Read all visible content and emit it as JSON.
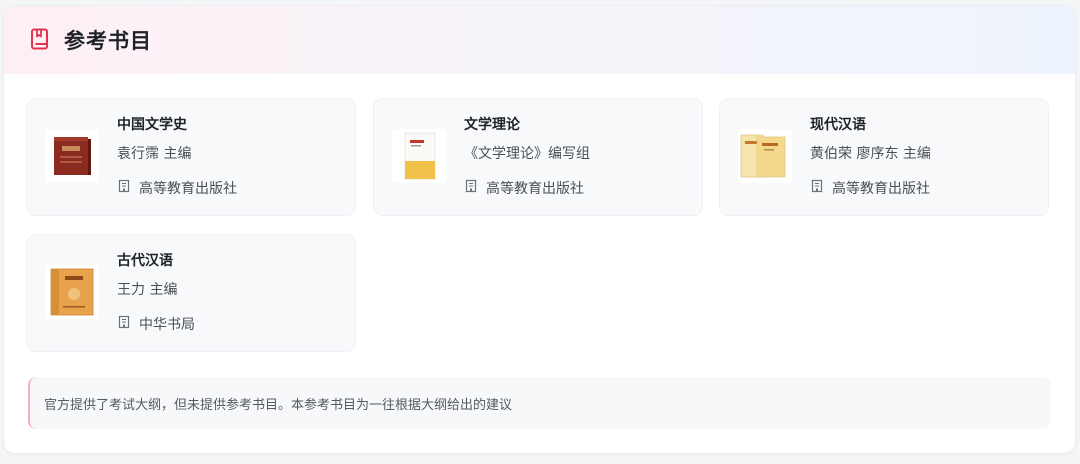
{
  "header": {
    "title": "参考书目",
    "icon": "book-icon",
    "accent_color": "#e0344f"
  },
  "books": [
    {
      "title": "中国文学史",
      "author": "袁行霈 主编",
      "publisher": "高等教育出版社",
      "cover_color": "#8b2a1f"
    },
    {
      "title": "文学理论",
      "author": "《文学理论》编写组",
      "publisher": "高等教育出版社",
      "cover_color": "#f1c24a"
    },
    {
      "title": "现代汉语",
      "author": "黄伯荣 廖序东 主编",
      "publisher": "高等教育出版社",
      "cover_color": "#f4d98c"
    },
    {
      "title": "古代汉语",
      "author": "王力 主编",
      "publisher": "中华书局",
      "cover_color": "#e8a24c"
    }
  ],
  "notice": {
    "text": "官方提供了考试大纲，但未提供参考书目。本参考书目为一往根据大纲给出的建议"
  }
}
